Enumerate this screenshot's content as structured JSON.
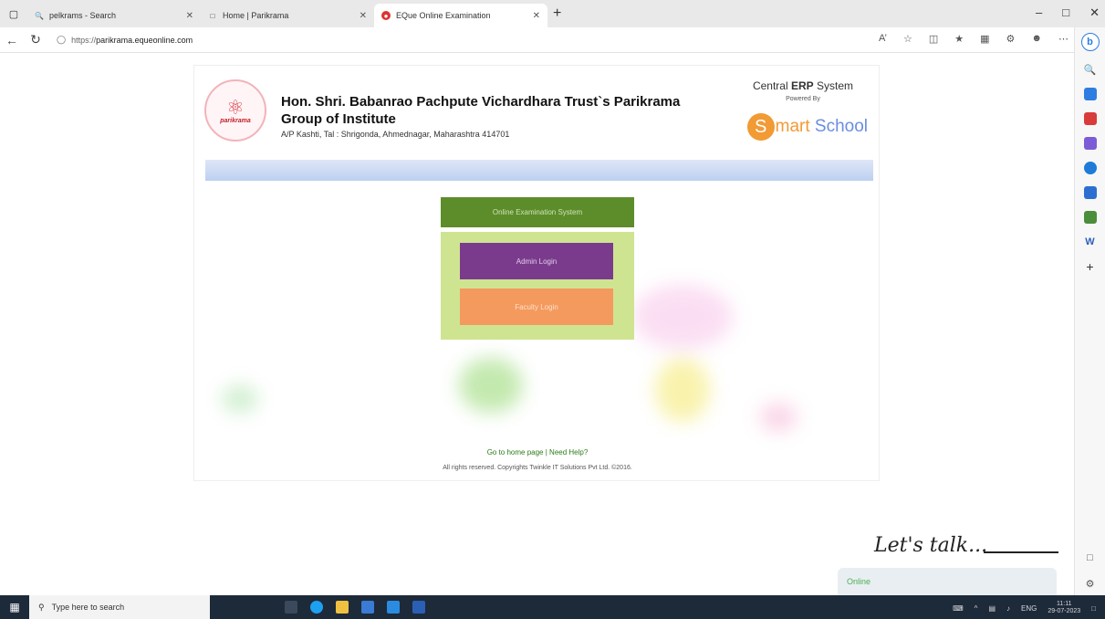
{
  "browser": {
    "tabs": [
      {
        "title": "pelkrams - Search",
        "active": false
      },
      {
        "title": "Home | Parikrama",
        "active": false
      },
      {
        "title": "EQue Online Examination",
        "active": true
      }
    ],
    "new_tab": "+",
    "url_prefix": "https://",
    "url_domain": "parikrama.equeonline.com",
    "window_controls": [
      "–",
      "□",
      "✕"
    ]
  },
  "header": {
    "institute_name": "Hon. Shri. Babanrao Pachpute Vichardhara Trust`s Parikrama Group of Institute",
    "address": "A/P Kashti, Tal : Shrigonda, Ahmednagar, Maharashtra 414701",
    "logo_text": "parikrama",
    "erp_title_prefix": "Central ",
    "erp_title_bold": "ERP",
    "erp_title_suffix": " System",
    "powered_by": "Powered By",
    "brand_initial": "S",
    "brand_rest": "mart",
    "brand_second": " School"
  },
  "exam": {
    "title": "Online Examination System",
    "admin_login": "Admin Login",
    "faculty_login": "Faculty Login"
  },
  "footer": {
    "home_link": "Go to home page",
    "separator": " | ",
    "help_link": "Need Help?",
    "copyright": "All rights reserved. Copyrights Twinkle IT Solutions Pvt Ltd. ©2016."
  },
  "chat": {
    "tagline": "Let's talk...",
    "status": "Online"
  },
  "taskbar": {
    "search_placeholder": "Type here to search",
    "lang": "ENG",
    "time": "11:11",
    "date": "29-07-2023"
  },
  "colors": {
    "exam_title_bg": "#5c8d2a",
    "login_box_bg": "#cfe490",
    "admin_btn": "#7a3b8d",
    "faculty_btn": "#f49a5e",
    "smart_orange": "#f29a34"
  }
}
